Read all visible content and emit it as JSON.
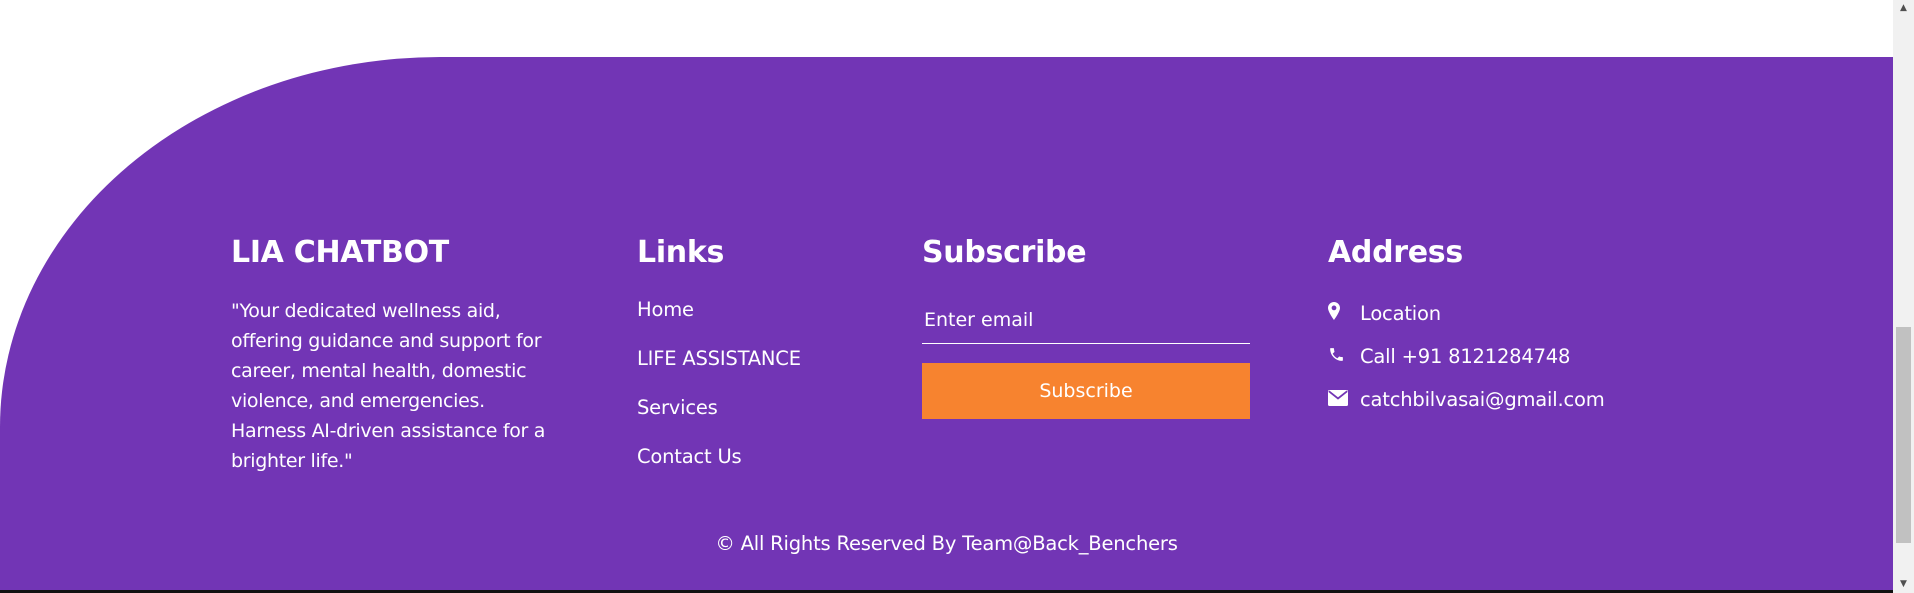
{
  "theme": {
    "footer_bg": "#7235b5",
    "accent": "#f7832f",
    "text": "#ffffff"
  },
  "about": {
    "title": "LIA CHATBOT",
    "description": "\"Your dedicated wellness aid, offering guidance and support for career, mental health, domestic violence, and emergencies. Harness AI-driven assistance for a brighter life.\""
  },
  "links": {
    "title": "Links",
    "items": [
      {
        "label": "Home"
      },
      {
        "label": "LIFE ASSISTANCE"
      },
      {
        "label": "Services"
      },
      {
        "label": "Contact Us"
      }
    ]
  },
  "subscribe": {
    "title": "Subscribe",
    "email_placeholder": "Enter email",
    "email_value": "",
    "button_label": "Subscribe"
  },
  "address": {
    "title": "Address",
    "items": [
      {
        "icon": "map-pin-icon",
        "text": "Location"
      },
      {
        "icon": "phone-icon",
        "text": "Call +91 8121284748"
      },
      {
        "icon": "envelope-icon",
        "text": "catchbilvasai@gmail.com"
      }
    ]
  },
  "copyright": "© All Rights Reserved By Team@Back_Benchers"
}
